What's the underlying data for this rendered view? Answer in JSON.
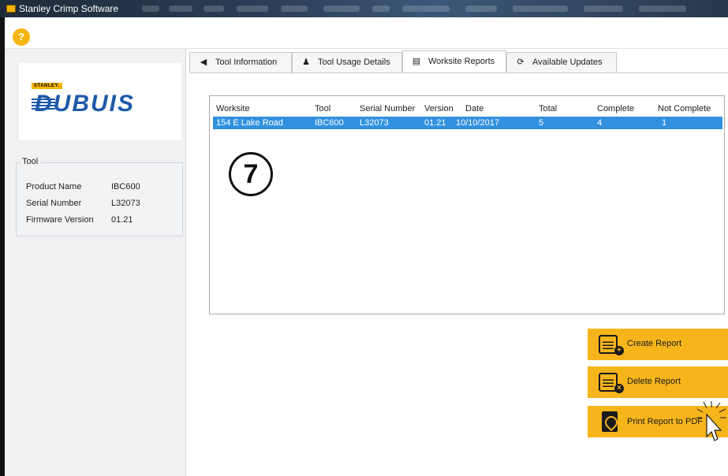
{
  "window": {
    "title": "Stanley Crimp Software"
  },
  "toolbar": {
    "help_label": "?"
  },
  "logo": {
    "brand_small": "STANLEY.",
    "brand": "DUBUIS"
  },
  "tool_panel": {
    "heading": "Tool",
    "properties": [
      {
        "label": "Product Name",
        "value": "IBC600"
      },
      {
        "label": "Serial Number",
        "value": "L32073"
      },
      {
        "label": "Firmware Version",
        "value": "01.21"
      }
    ]
  },
  "tabs": [
    {
      "label": "Tool Information",
      "icon": "drill-icon",
      "active": false
    },
    {
      "label": "Tool Usage Details",
      "icon": "person-icon",
      "active": false
    },
    {
      "label": "Worksite Reports",
      "icon": "list-icon",
      "active": true
    },
    {
      "label": "Available Updates",
      "icon": "refresh-icon",
      "active": false
    }
  ],
  "report_table": {
    "columns": [
      "Worksite",
      "Tool",
      "Serial Number",
      "Version",
      "Date",
      "Total",
      "Complete",
      "Not Complete"
    ],
    "rows": [
      [
        "154 E Lake Road",
        "IBC600",
        "L32073",
        "01.21",
        "10/10/2017",
        "5",
        "4",
        "1"
      ]
    ],
    "selected_row": 0
  },
  "step_marker": "7",
  "actions": {
    "create": "Create Report",
    "delete": "Delete Report",
    "print": "Print Report to PDF"
  },
  "colors": {
    "accent": "#f7b51c",
    "selection": "#3191e0",
    "brand_blue": "#1e5aa8"
  }
}
